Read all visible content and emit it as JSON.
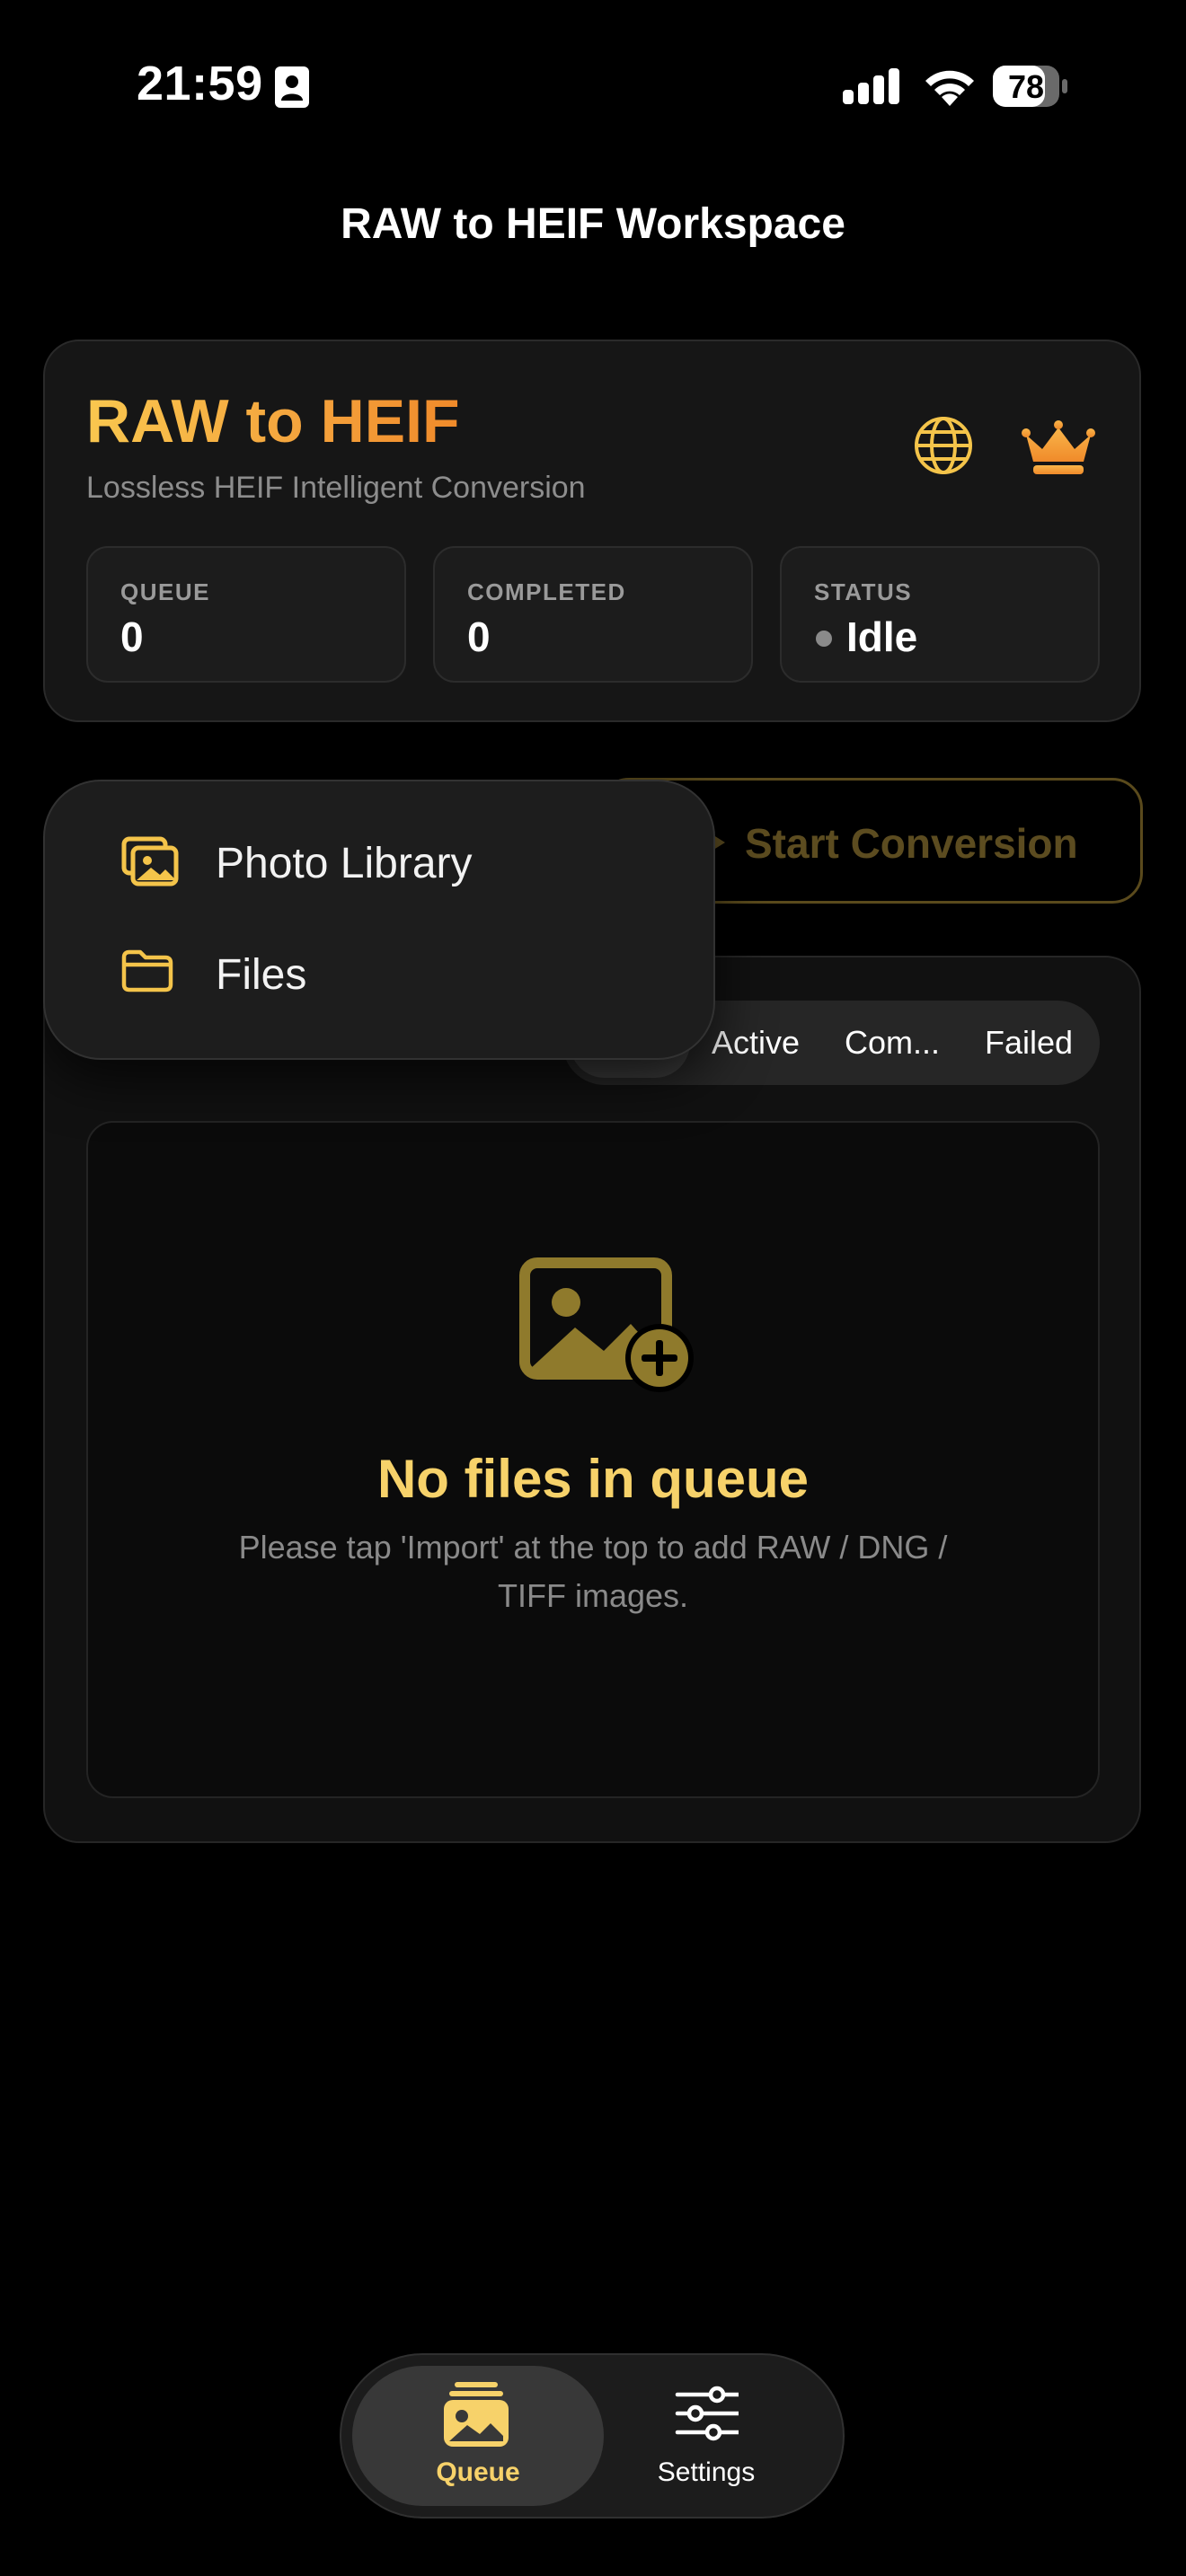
{
  "status_bar": {
    "time": "21:59",
    "battery": "78"
  },
  "nav": {
    "title": "RAW to HEIF Workspace"
  },
  "header": {
    "title": "RAW to HEIF",
    "subtitle": "Lossless HEIF Intelligent Conversion",
    "icons": [
      "globe-icon",
      "crown-icon"
    ],
    "stats": [
      {
        "label": "QUEUE",
        "value": "0"
      },
      {
        "label": "COMPLETED",
        "value": "0"
      },
      {
        "label": "STATUS",
        "value": "Idle"
      }
    ]
  },
  "actions": {
    "start_label": "Start Conversion"
  },
  "import_menu": {
    "items": [
      {
        "label": "Photo Library",
        "icon": "photo-library-icon"
      },
      {
        "label": "Files",
        "icon": "folder-icon"
      }
    ]
  },
  "filter": {
    "items": [
      "Active",
      "Com...",
      "Failed"
    ],
    "selected_index": 0
  },
  "empty_state": {
    "title": "No files in queue",
    "description": "Please tap 'Import' at the top to add RAW / DNG / TIFF images."
  },
  "tabbar": {
    "tabs": [
      {
        "label": "Queue",
        "icon": "queue-photos-icon",
        "selected": true
      },
      {
        "label": "Settings",
        "icon": "sliders-icon",
        "selected": false
      }
    ]
  },
  "colors": {
    "accent": "#f7d26a",
    "brand_gradient_start": "#f9c74f",
    "brand_gradient_end": "#f08a2a",
    "background": "#000000"
  }
}
